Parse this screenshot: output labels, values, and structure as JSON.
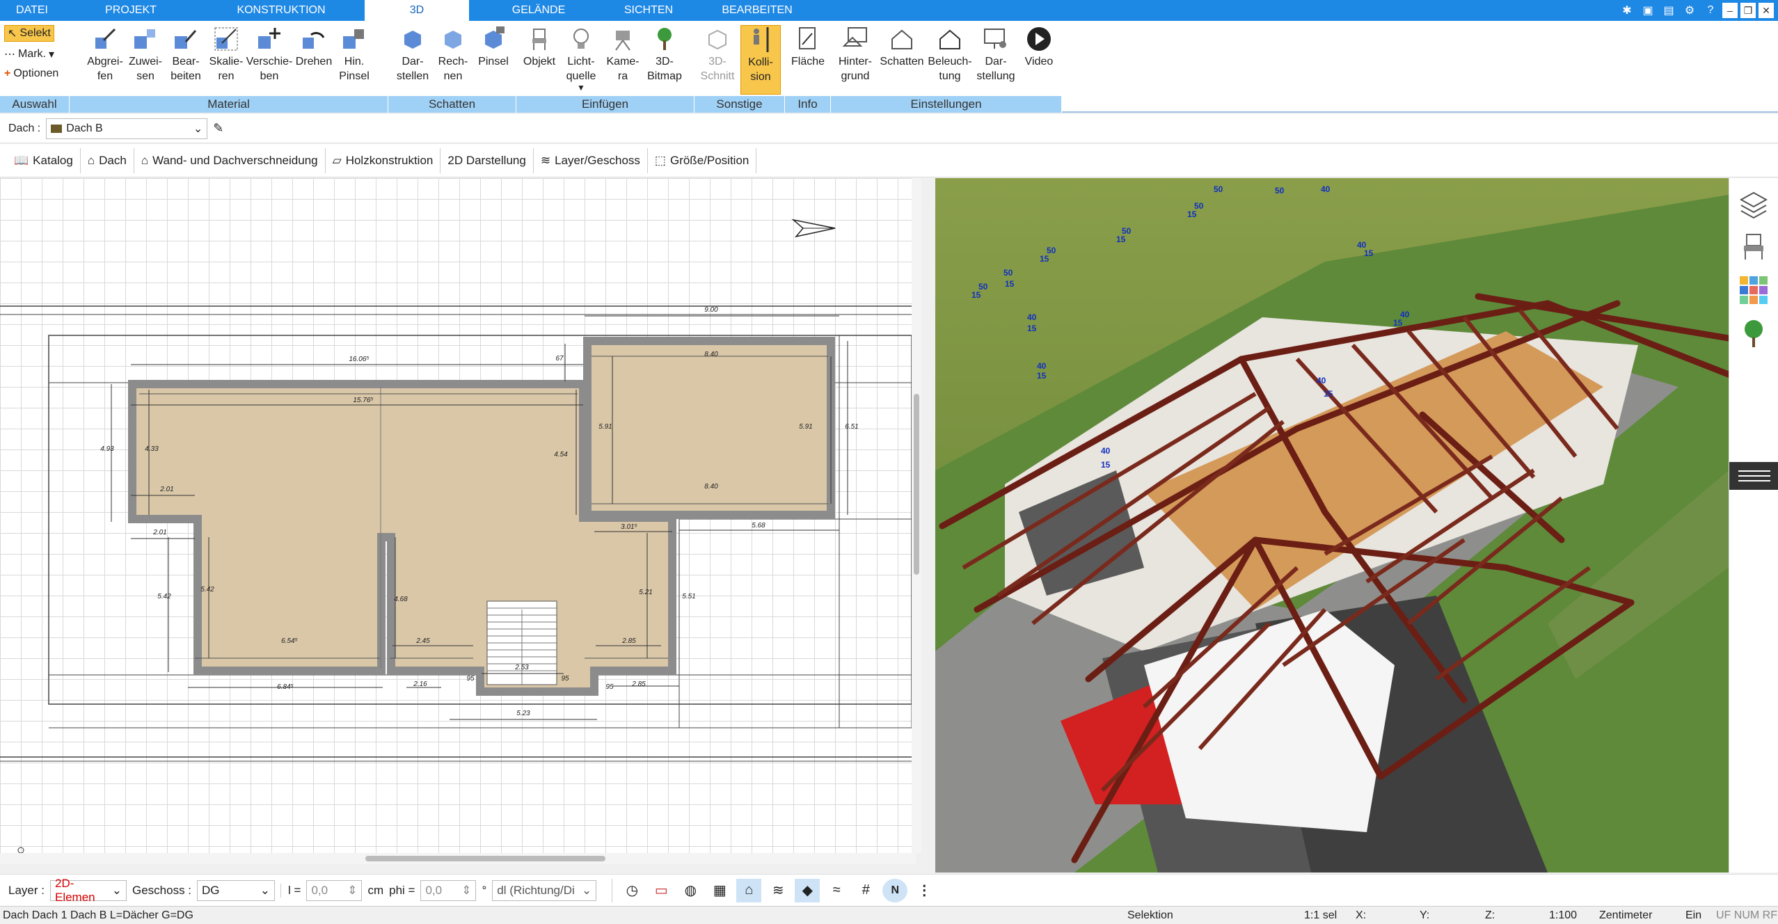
{
  "menubar": {
    "tabs": [
      "DATEI",
      "PROJEKT",
      "KONSTRUKTION",
      "3D",
      "GELÄNDE",
      "SICHTEN",
      "BEARBEITEN"
    ],
    "active_tab": "3D"
  },
  "ribbon": {
    "auswahl": {
      "select": "Selekt",
      "mark": "Mark.",
      "options": "Optionen",
      "label": "Auswahl"
    },
    "material": {
      "label": "Material",
      "buttons": [
        "Abgrei-\nfen",
        "Zuwei-\nsen",
        "Bear-\nbeiten",
        "Skalie-\nren",
        "Verschie-\nben",
        "Drehen",
        "Hin.\nPinsel"
      ]
    },
    "schatten": {
      "label": "Schatten",
      "buttons": [
        "Dar-\nstellen",
        "Rech-\nnen",
        "Pinsel"
      ]
    },
    "einfuegen": {
      "label": "Einfügen",
      "buttons": [
        "Objekt",
        "Licht-\nquelle",
        "Kame-\nra",
        "3D-\nBitmap"
      ]
    },
    "sonstige": {
      "label": "Sonstige",
      "buttons": [
        "3D-\nSchnitt",
        "Kolli-\nsion"
      ]
    },
    "info": {
      "label": "Info",
      "buttons": [
        "Fläche"
      ]
    },
    "einstellungen": {
      "label": "Einstellungen",
      "buttons": [
        "Hinter-\ngrund",
        "Schatten",
        "Beleuch-\ntung",
        "Dar-\nstellung",
        "Video"
      ]
    }
  },
  "property_row": {
    "label": "Dach :",
    "value": "Dach B"
  },
  "toolbar": {
    "items": [
      "Katalog",
      "Dach",
      "Wand- und Dachverschneidung",
      "Holzkonstruktion",
      "2D Darstellung",
      "Layer/Geschoss",
      "Größe/Position"
    ]
  },
  "plan": {
    "dimensions": [
      "9.00",
      "16.06⁵",
      "15.76⁵",
      "8.40",
      "8.40",
      "5.91",
      "5.91",
      "6.51",
      "4.93",
      "4.33",
      "4.54",
      "2.01",
      "2.01",
      "3.01⁵",
      "5.68",
      "5.42",
      "5.42",
      "4.68",
      "5.21",
      "5.51",
      "6.54⁵",
      "2.45",
      "2.85",
      "2.53",
      "6.84⁵",
      "2.16",
      "95",
      "95",
      "95",
      "2.85",
      "5.23",
      "67"
    ]
  },
  "view3d": {
    "labels": [
      "50",
      "50",
      "40",
      "50",
      "15",
      "50",
      "15",
      "50",
      "15",
      "50",
      "15",
      "50",
      "15",
      "40",
      "15",
      "40",
      "15",
      "40",
      "15",
      "40",
      "15",
      "40",
      "15",
      "40",
      "15"
    ]
  },
  "bottombar": {
    "layer_label": "Layer :",
    "layer_value": "2D-Elemen",
    "geschoss_label": "Geschoss :",
    "geschoss_value": "DG",
    "l_label": "l =",
    "l_value": "0,0",
    "l_unit": "cm",
    "phi_label": "phi =",
    "phi_value": "0,0",
    "phi_unit": "°",
    "mode_value": "dl (Richtung/Di"
  },
  "statusbar": {
    "left": "Dach Dach 1 Dach B L=Dächer G=DG",
    "selektion": "Selektion",
    "sel": "1:1 sel",
    "x": "X:",
    "y": "Y:",
    "z": "Z:",
    "scale": "1:100",
    "unit": "Zentimeter",
    "ein": "Ein",
    "flags": "UF NUM RF"
  },
  "colors": {
    "accent": "#1e88e5",
    "group_label": "#9fd0f5",
    "active_button": "#f8c64a",
    "floor": "#d9c7a8",
    "wall": "#8c8c8c",
    "roof": "#6b1e14"
  }
}
